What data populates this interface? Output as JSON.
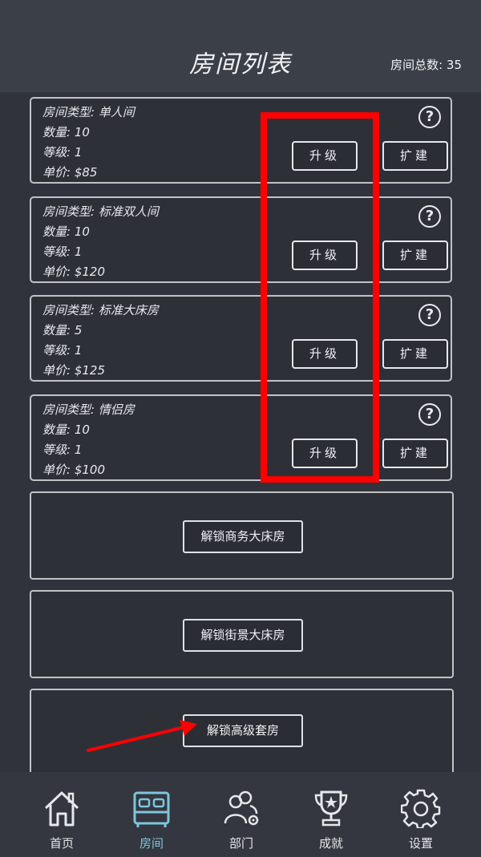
{
  "header": {
    "title": "房间列表",
    "total_label": "房间总数: 35"
  },
  "rooms": [
    {
      "type": "房间类型: 单人间",
      "count": "数量: 10",
      "level": "等级: 1",
      "price": "单价: $85"
    },
    {
      "type": "房间类型: 标准双人间",
      "count": "数量: 10",
      "level": "等级: 1",
      "price": "单价: $120"
    },
    {
      "type": "房间类型: 标准大床房",
      "count": "数量: 5",
      "level": "等级: 1",
      "price": "单价: $125"
    },
    {
      "type": "房间类型: 情侣房",
      "count": "数量: 10",
      "level": "等级: 1",
      "price": "单价: $100"
    }
  ],
  "buttons": {
    "upgrade": "升级",
    "expand": "扩建",
    "help": "?"
  },
  "unlocks": [
    "解锁商务大床房",
    "解锁街景大床房",
    "解锁高级套房"
  ],
  "nav": {
    "items": [
      {
        "label": "首页",
        "icon": "home-icon"
      },
      {
        "label": "房间",
        "icon": "bed-icon"
      },
      {
        "label": "部门",
        "icon": "people-gear-icon"
      },
      {
        "label": "成就",
        "icon": "trophy-icon"
      },
      {
        "label": "设置",
        "icon": "gear-icon"
      }
    ],
    "active": "房间"
  },
  "colors": {
    "highlight": "#ff0000",
    "active_nav": "#7ec6dd",
    "background": "#3b3f48"
  }
}
